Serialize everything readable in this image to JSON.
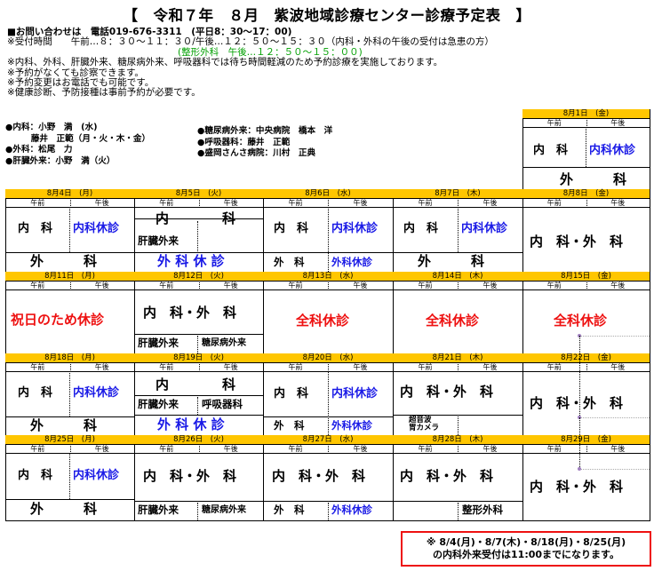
{
  "title": "【　令和７年　８月　紫波地域診療センター診療予定表　】",
  "info": {
    "lines": [
      "■お問い合わせは　電話019-676-3311　(平日8：30～17：00)",
      "※受付時間　　午前…８：３０～１１：３０/午後…１２：５０～１５：３０（内科・外科の午後の受付は急患の方）",
      "(整形外科　午後…１２：５０～１５：００)",
      "※内科、外科、肝臓外来、糖尿病外来、呼吸器科では待ち時間軽減のため予約診療を実施しております。",
      "※予約がなくても診察できます。",
      "※予約変更はお電話でも可能です。",
      "※健康診断、予防接種は事前予約が必要です。"
    ]
  },
  "doctors_left": [
    "●内科：小野　満　(水)",
    "　　　藤井　正範（月・火・木・金）",
    "●外科：松尾　力",
    "●肝臓外来：小野　満（火）"
  ],
  "doctors_right": [
    "●糖尿病外来：中央病院　橋本　洋",
    "●呼吸器科：藤井　正範",
    "●盛岡さんさ病院：川村　正典"
  ],
  "labels": {
    "am": "午前",
    "pm": "午後",
    "naika": "内　科",
    "naika_kyushin": "内科休診",
    "geka": "外　　　科",
    "geka_wide": "外　　　　科",
    "naika_geka": "内　科・外　科",
    "kanzo": "肝臓外来",
    "tonyo": "糖尿病外来",
    "kokyu": "呼吸器科",
    "geka_kyushin": "外 科 休 診",
    "geka_short": "外　科",
    "geka_kyushin2": "外科休診",
    "shukujitsu": "祝日のため休診",
    "zenka": "全科休診",
    "naika_short": "内　　　　科",
    "chouonpa": "超音波",
    "ikamera": "胃カメラ",
    "seikei": "整形外科"
  },
  "dates": {
    "d1": "8月1日　(金)",
    "d4": "8月4日　(月)",
    "d5": "8月5日　(火)",
    "d6": "8月6日　(水)",
    "d7": "8月7日　(木)",
    "d8": "8月8日　(金)",
    "d11": "8月11日　(月)",
    "d12": "8月12日　(火)",
    "d13": "8月13日　(水)",
    "d14": "8月14日　(木)",
    "d15": "8月15日　(金)",
    "d18": "8月18日　(月)",
    "d19": "8月19日　(火)",
    "d20": "8月20日　(水)",
    "d21": "8月21日　(木)",
    "d22": "8月22日　(金)",
    "d25": "8月25日　(月)",
    "d26": "8月26日　(火)",
    "d27": "8月27日　(水)",
    "d28": "8月28日　(木)",
    "d29": "8月29日　(金)"
  },
  "note": {
    "line1": "※ 8/4(月)・8/7(木)・8/18(月)・8/25(月)",
    "line2": "の内科外来受付は11:00までになります。"
  },
  "colors": {
    "header": "#ffc600",
    "blue": "#1919e6",
    "red": "#ee1111",
    "green": "#00a000"
  }
}
